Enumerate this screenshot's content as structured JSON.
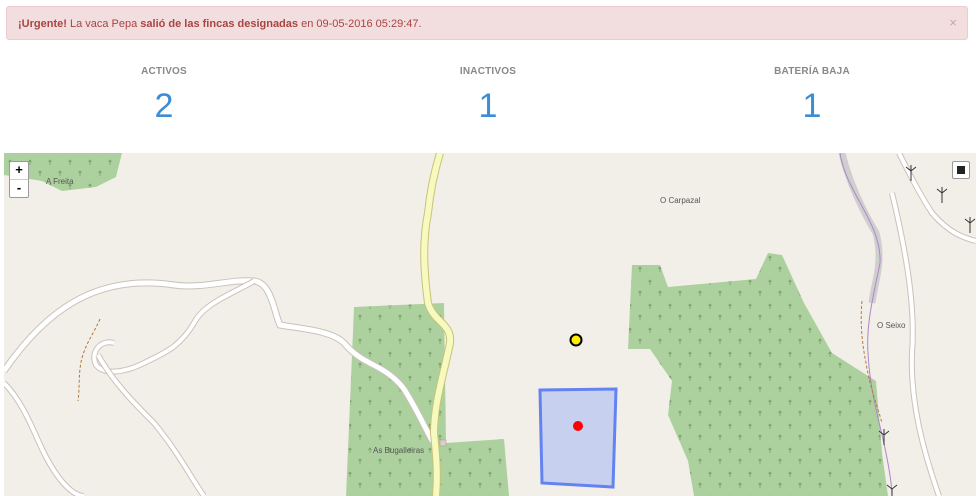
{
  "alert": {
    "prefix": "¡Urgente!",
    "text_1": " La vaca Pepa ",
    "highlight": "salió de las fincas designadas",
    "text_2": " en 09-05-2016 05:29:47.",
    "close": "×"
  },
  "stats": [
    {
      "label": "ACTIVOS",
      "value": "2"
    },
    {
      "label": "INACTIVOS",
      "value": "1"
    },
    {
      "label": "BATERÍA BAJA",
      "value": "1"
    }
  ],
  "map": {
    "zoom_in": "+",
    "zoom_out": "-",
    "places": {
      "a_freita": "A Freita",
      "o_carpazal": "O Carpazal",
      "o_seixo": "O Seixo",
      "as_bugalleiras": "As Bugalleiras"
    },
    "colors": {
      "land": "#f2efe9",
      "forest": "#add19e",
      "road": "#ffffff",
      "main_road": "#f7fabf",
      "fence_fill": "#c5cdf0",
      "fence_stroke": "#6383f0",
      "animal_inside": "#ff0000",
      "animal_low_battery": "#ffee00"
    }
  }
}
